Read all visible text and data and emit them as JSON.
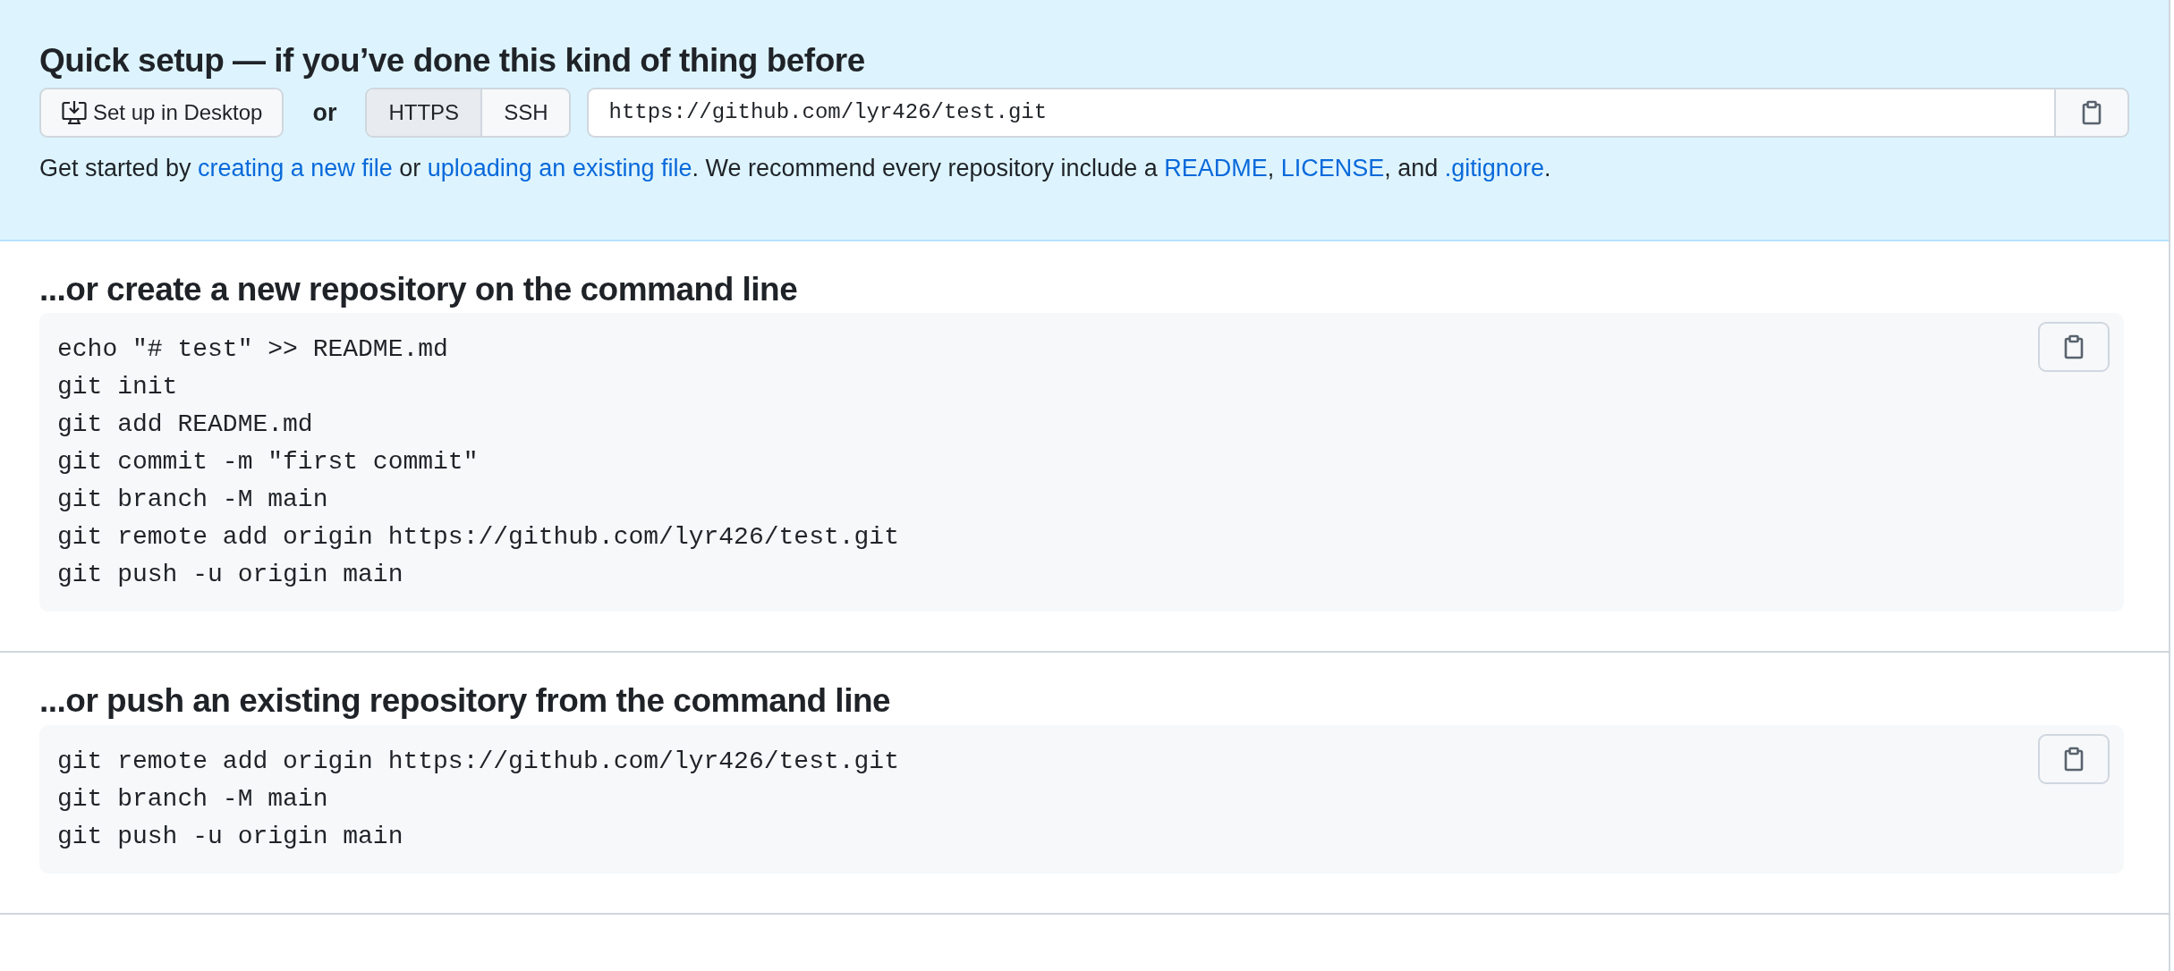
{
  "quick_setup": {
    "title": "Quick setup — if you’ve done this kind of thing before",
    "desktop_button": "Set up in Desktop",
    "or_label": "or",
    "protocols": [
      {
        "label": "HTTPS",
        "selected": true
      },
      {
        "label": "SSH",
        "selected": false
      }
    ],
    "clone_url": "https://github.com/lyr426/test.git",
    "intro": [
      {
        "kind": "text",
        "text": "Get started by "
      },
      {
        "kind": "link",
        "text": "creating a new file"
      },
      {
        "kind": "text",
        "text": " or "
      },
      {
        "kind": "link",
        "text": "uploading an existing file"
      },
      {
        "kind": "text",
        "text": ". We recommend every repository include a "
      },
      {
        "kind": "link",
        "text": "README"
      },
      {
        "kind": "text",
        "text": ", "
      },
      {
        "kind": "link",
        "text": "LICENSE"
      },
      {
        "kind": "text",
        "text": ", and "
      },
      {
        "kind": "link",
        "text": ".gitignore"
      },
      {
        "kind": "text",
        "text": "."
      }
    ]
  },
  "sections": [
    {
      "title": "...or create a new repository on the command line",
      "lines": [
        "echo \"# test\" >> README.md",
        "git init",
        "git add README.md",
        "git commit -m \"first commit\"",
        "git branch -M main",
        "git remote add origin https://github.com/lyr426/test.git",
        "git push -u origin main"
      ]
    },
    {
      "title": "...or push an existing repository from the command line",
      "lines": [
        "git remote add origin https://github.com/lyr426/test.git",
        "git branch -M main",
        "git push -u origin main"
      ]
    }
  ]
}
